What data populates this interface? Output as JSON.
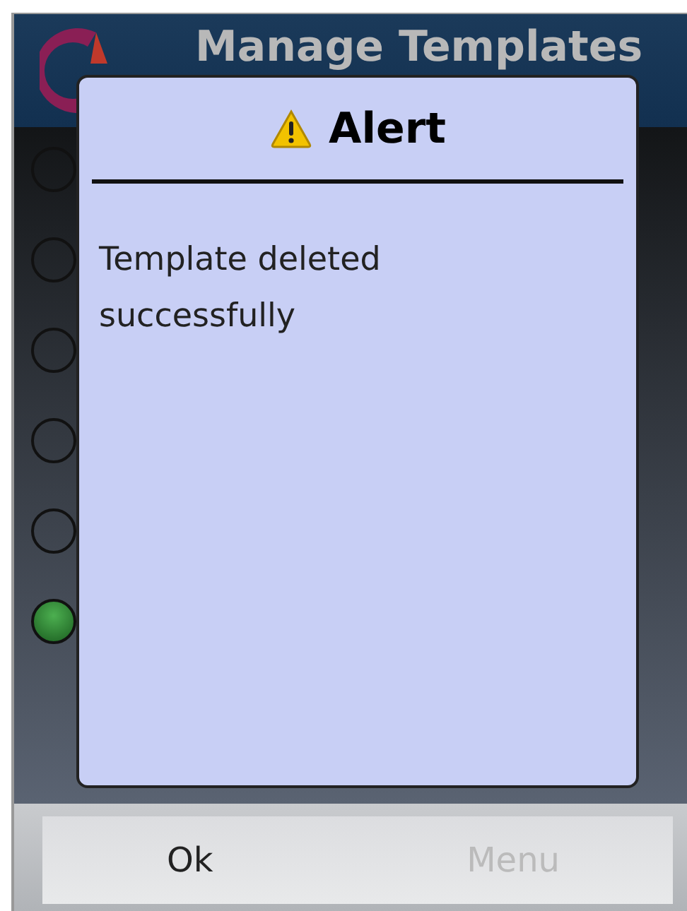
{
  "screen": {
    "title": "Manage Templates"
  },
  "radios": [
    {
      "selected": false
    },
    {
      "selected": false
    },
    {
      "selected": false
    },
    {
      "selected": false
    },
    {
      "selected": false
    },
    {
      "selected": true
    }
  ],
  "softkeys": {
    "right": "Menu"
  },
  "dialog": {
    "title": "Alert",
    "message": "Template deleted successfully",
    "button": "Ok"
  }
}
